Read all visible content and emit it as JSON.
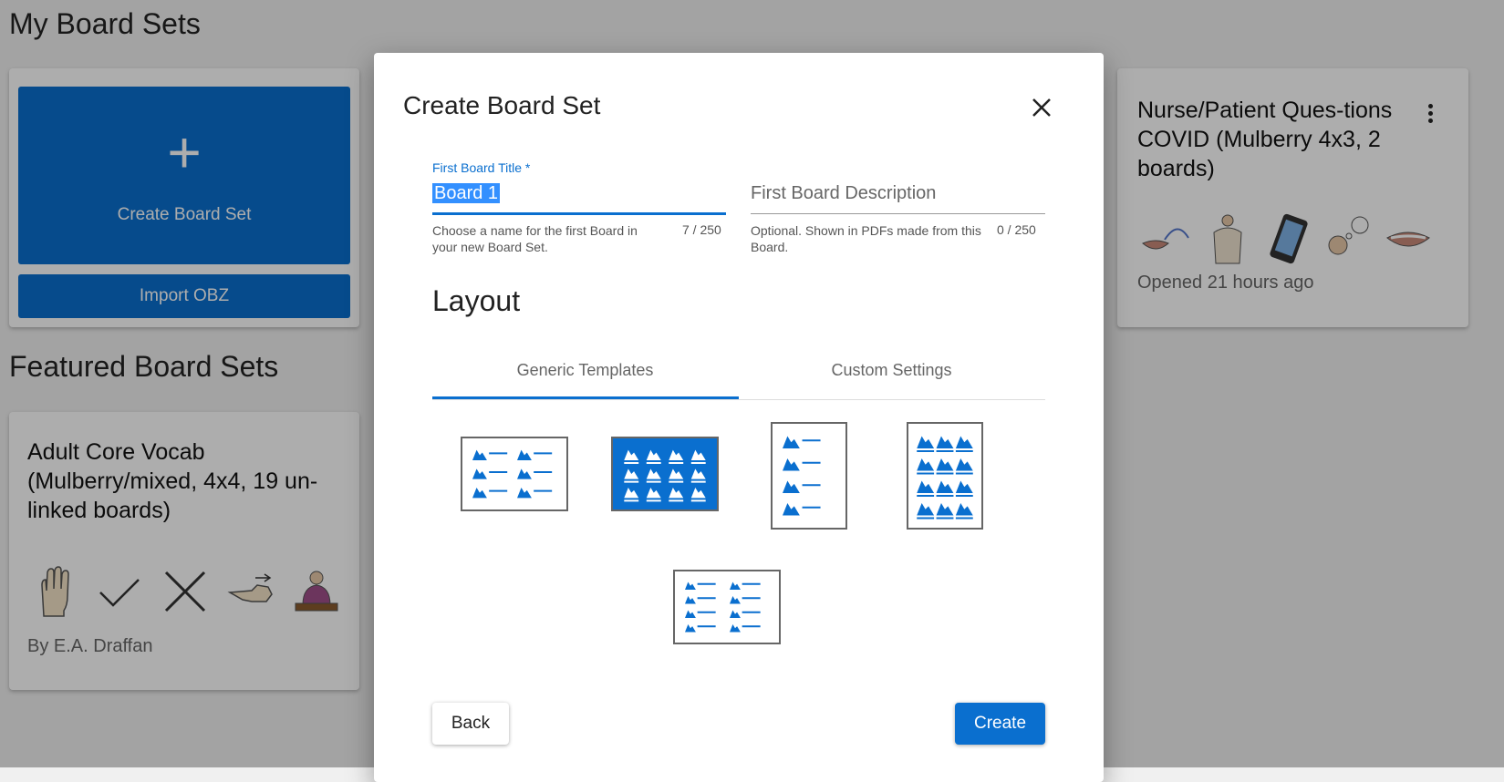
{
  "page": {
    "my_board_sets_heading": "My Board Sets",
    "featured_heading": "Featured Board Sets"
  },
  "create_card": {
    "plus_icon": "+",
    "create_label": "Create Board Set",
    "import_label": "Import OBZ"
  },
  "featured_card": {
    "title": "Adult Core Vocab (Mulberry/mixed, 4x4, 19 un-linked boards)",
    "byline": "By E.A. Draffan",
    "symbols": [
      "raised-hand-icon",
      "checkmark-icon",
      "cross-icon",
      "hand-gesture-icon",
      "person-at-table-icon"
    ]
  },
  "recent_card": {
    "title": "Nurse/Patient Ques-tions COVID (Mulberry 4x3, 2 boards)",
    "status": "Opened 21 hours ago",
    "symbols": [
      "mouth-tube-icon",
      "hospital-gown-icon",
      "phone-icon",
      "person-thinking-icon",
      "mouth-icon"
    ]
  },
  "modal": {
    "title": "Create Board Set",
    "title_field": {
      "label": "First Board Title *",
      "value": "Board 1",
      "hint": "Choose a name for the first Board in your new Board Set.",
      "counter": "7 / 250"
    },
    "description_field": {
      "placeholder": "First Board Description",
      "hint": "Optional. Shown in PDFs made from this Board.",
      "counter": "0 / 250"
    },
    "layout_heading": "Layout",
    "tabs": [
      {
        "label": "Generic Templates",
        "active": true
      },
      {
        "label": "Custom Settings",
        "active": false
      }
    ],
    "templates": [
      {
        "name": "landscape-2x3",
        "selected": false
      },
      {
        "name": "landscape-4x3",
        "selected": true
      },
      {
        "name": "portrait-1x4",
        "selected": false
      },
      {
        "name": "portrait-3x4",
        "selected": false
      },
      {
        "name": "landscape-2x4",
        "selected": false
      }
    ],
    "back_label": "Back",
    "create_label": "Create"
  },
  "colors": {
    "accent": "#0a6fcf",
    "overlay": "rgba(0,0,0,0.32)"
  }
}
